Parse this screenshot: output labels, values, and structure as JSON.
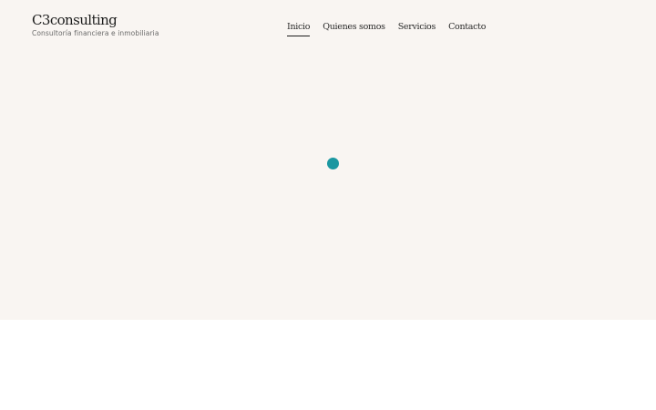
{
  "brand": {
    "logo": "C3consulting",
    "tagline": "Consultoría financiera e inmobiliaria"
  },
  "nav": {
    "items": [
      {
        "label": "Inicio",
        "active": true
      },
      {
        "label": "Quienes somos",
        "active": false
      },
      {
        "label": "Servicios",
        "active": false
      },
      {
        "label": "Contacto",
        "active": false
      }
    ]
  },
  "loader": {
    "icon": "spinner-dot-icon",
    "color": "#1b97a1"
  },
  "colors": {
    "hero_background": "#f9f5f2",
    "page_background": "#ffffff",
    "text": "#1c1c1c"
  }
}
